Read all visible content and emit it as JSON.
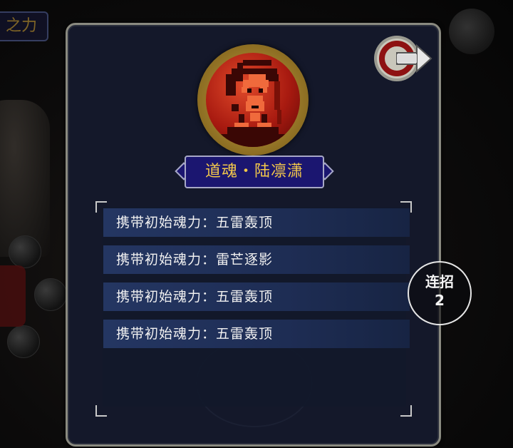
{
  "background": {
    "tab_label": "之力"
  },
  "character": {
    "name": "道魂・陆凛潇",
    "portrait_icon": "red-warrior-portrait-icon"
  },
  "close_button": {
    "icon": "exit-arrow-icon"
  },
  "soul_powers": [
    {
      "label": "携带初始魂力：五雷轰顶"
    },
    {
      "label": "携带初始魂力：雷芒逐影"
    },
    {
      "label": "携带初始魂力：五雷轰顶"
    },
    {
      "label": "携带初始魂力：五雷轰顶"
    }
  ],
  "combo": {
    "label": "连招",
    "count": "2"
  },
  "colors": {
    "panel_bg": "#14182a",
    "name_text": "#f3c84a",
    "name_plate": "#1b1670",
    "list_row": "#243662",
    "portrait_red": "#a81a10",
    "frame_gold": "#c9a646"
  }
}
